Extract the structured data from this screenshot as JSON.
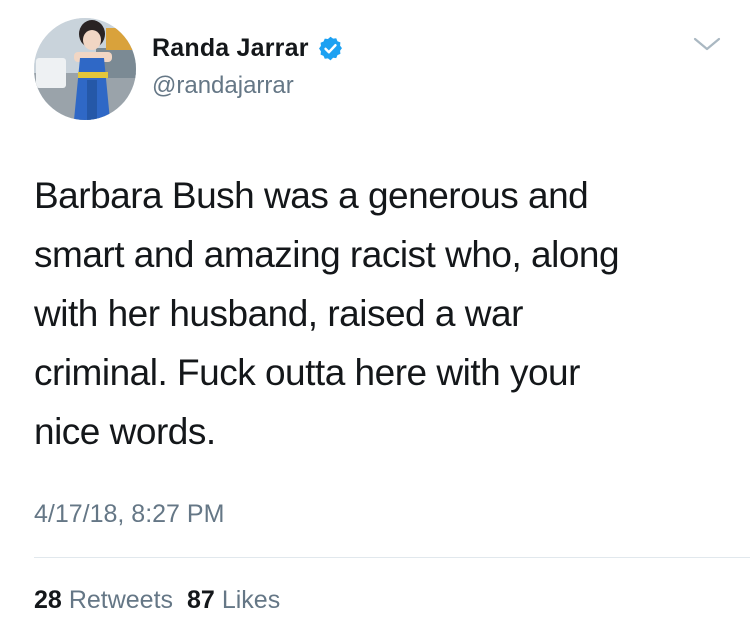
{
  "author": {
    "display_name": "Randa Jarrar",
    "handle": "@randajarrar",
    "verified": true,
    "avatar_icon": "profile-avatar"
  },
  "tweet": {
    "text": "Barbara Bush was a generous and\nsmart and amazing racist who, along\nwith her husband, raised a war\ncriminal. Fuck outta here with your\nnice words.",
    "timestamp": "4/17/18, 8:27 PM"
  },
  "stats": {
    "retweets_count": "28",
    "retweets_label": "Retweets",
    "likes_count": "87",
    "likes_label": "Likes"
  },
  "colors": {
    "verified_blue": "#1da1f2",
    "secondary_text": "#657786",
    "primary_text": "#14171a",
    "divider": "#e1e8ed"
  },
  "icons": {
    "verified": "verified-badge-icon",
    "menu": "chevron-down-icon"
  }
}
